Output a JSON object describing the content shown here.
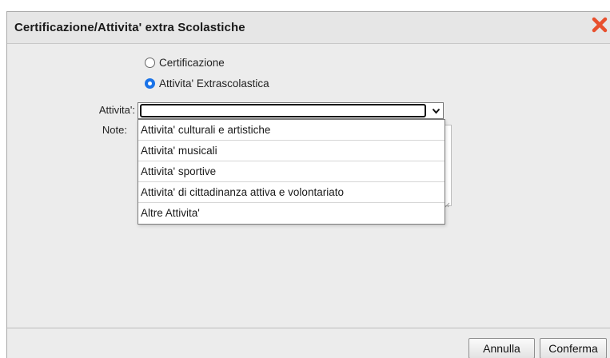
{
  "dialog": {
    "title": "Certificazione/Attivita' extra Scolastiche",
    "close_icon": "close-x-icon",
    "accent_color": "#e8502e"
  },
  "form": {
    "radio_options": [
      {
        "label": "Certificazione",
        "checked": false
      },
      {
        "label": "Attivita' Extrascolastica",
        "checked": true
      }
    ],
    "activity_label": "Attivita':",
    "activity_value": "",
    "note_label": "Note:"
  },
  "dropdown": {
    "options": [
      "Attivita' culturali e artistiche",
      "Attivita' musicali",
      "Attivita' sportive",
      "Attivita' di cittadinanza attiva e volontariato",
      "Altre Attivita'"
    ]
  },
  "footer": {
    "cancel_label": "Annulla",
    "confirm_label": "Conferma"
  }
}
